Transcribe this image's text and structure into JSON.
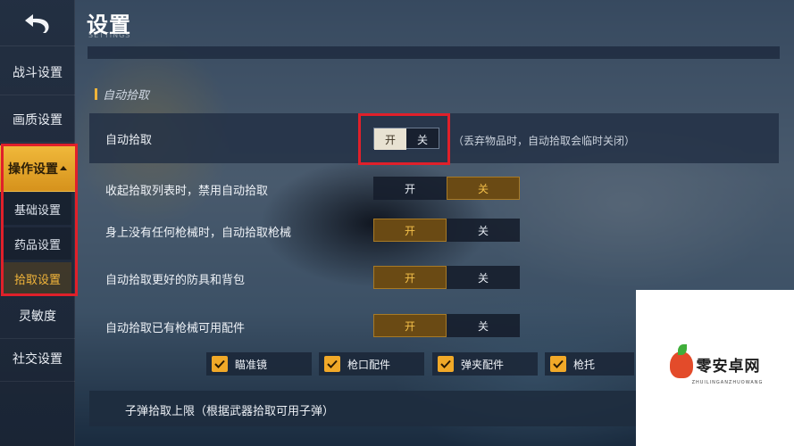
{
  "header": {
    "title": "设置",
    "subtitle": "SETTINGS"
  },
  "sidebar": {
    "items": [
      {
        "label": "战斗设置"
      },
      {
        "label": "画质设置"
      },
      {
        "label": "操作设置"
      },
      {
        "label": "灵敏度"
      },
      {
        "label": "社交设置"
      }
    ],
    "sub_items": [
      {
        "label": "基础设置"
      },
      {
        "label": "药品设置"
      },
      {
        "label": "拾取设置"
      }
    ]
  },
  "section": {
    "title": "自动拾取"
  },
  "settings": [
    {
      "label": "自动拾取",
      "on": "开",
      "off": "关",
      "state": "on",
      "hint": "（丢弃物品时，自动拾取会临时关闭）"
    },
    {
      "label": "收起拾取列表时，禁用自动拾取",
      "on": "开",
      "off": "关",
      "state": "off"
    },
    {
      "label": "身上没有任何枪械时，自动拾取枪械",
      "on": "开",
      "off": "关",
      "state": "on"
    },
    {
      "label": "自动拾取更好的防具和背包",
      "on": "开",
      "off": "关",
      "state": "on"
    },
    {
      "label": "自动拾取已有枪械可用配件",
      "on": "开",
      "off": "关",
      "state": "on"
    }
  ],
  "attachments": [
    {
      "label": "瞄准镜",
      "checked": true
    },
    {
      "label": "枪口配件",
      "checked": true
    },
    {
      "label": "弹夹配件",
      "checked": true
    },
    {
      "label": "枪托",
      "checked": true
    }
  ],
  "ammo_limit": {
    "label": "子弹拾取上限（根据武器拾取可用子弹）"
  },
  "watermark": {
    "text": "零安卓网",
    "sub": "ZHUILINGANZHUOWANG"
  },
  "colors": {
    "accent": "#f0b43a",
    "highlight_box": "#e0202a"
  }
}
